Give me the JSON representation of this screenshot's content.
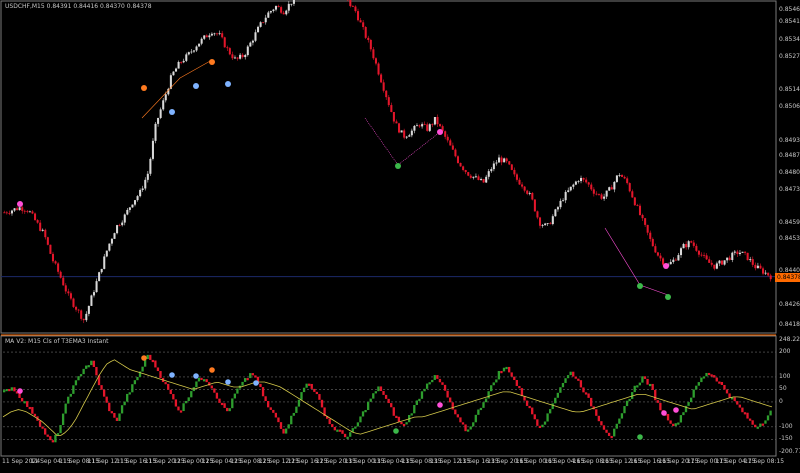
{
  "window": {
    "symbol_line": "USDCHF,M15  0.84391 0.84416 0.84370 0.84378",
    "indicator_line": "MA V2: M15 Cls of T3EMA3 Instant",
    "current_price": "0.84378"
  },
  "colors": {
    "background": "#000000",
    "axis": "#7a7a7a",
    "candle_up": "#d9d9d9",
    "candle_down": "#e4162b",
    "osc_up": "#2e9e2e",
    "osc_down": "#e4162b",
    "signal_line": "#d4c84a",
    "marker_buy": "#3cb84a",
    "marker_sell": "#ff4fd8",
    "marker_neutral": "#ff7a20",
    "marker_blue": "#7fb3ff",
    "current_box": "#ff6a00"
  },
  "price_axis": [
    "0.85465",
    "0.85415",
    "0.85344",
    "0.85273",
    "0.85140",
    "0.85069",
    "0.84931",
    "0.84870",
    "0.84800",
    "0.84730",
    "0.84595",
    "0.84530",
    "0.84402",
    "0.84378",
    "0.84261",
    "0.84181"
  ],
  "indicator_axis": [
    "248.2259",
    "200",
    "100",
    "50",
    "0",
    "-100",
    "-150",
    "-200.7791"
  ],
  "time_axis": [
    "11 Sep 2024",
    "11 Sep 04:15",
    "11 Sep 08:15",
    "11 Sep 12:15",
    "11 Sep 16:15",
    "11 Sep 20:15",
    "12 Sep 00:15",
    "12 Sep 04:15",
    "12 Sep 08:15",
    "12 Sep 12:15",
    "12 Sep 16:15",
    "12 Sep 20:15",
    "13 Sep 00:15",
    "13 Sep 04:15",
    "13 Sep 08:15",
    "13 Sep 12:15",
    "13 Sep 16:15",
    "13 Sep 20:15",
    "16 Sep 00:15",
    "16 Sep 04:15",
    "16 Sep 08:15",
    "16 Sep 12:15",
    "16 Sep 16:15",
    "16 Sep 20:15",
    "17 Sep 00:15",
    "17 Sep 04:15",
    "17 Sep 08:15"
  ],
  "chart_data": {
    "type": "line",
    "price_series": [
      0.8464,
      0.8465,
      0.8466,
      0.8465,
      0.846,
      0.8455,
      0.8445,
      0.8438,
      0.843,
      0.8425,
      0.842,
      0.843,
      0.844,
      0.845,
      0.8458,
      0.8462,
      0.8468,
      0.8472,
      0.848,
      0.85,
      0.851,
      0.852,
      0.8525,
      0.8528,
      0.8532,
      0.8535,
      0.8538,
      0.8536,
      0.853,
      0.8526,
      0.8528,
      0.8534,
      0.854,
      0.8545,
      0.8548,
      0.8546,
      0.855,
      0.8552,
      0.8556,
      0.8562,
      0.856,
      0.8558,
      0.8554,
      0.855,
      0.8546,
      0.8538,
      0.853,
      0.852,
      0.851,
      0.85,
      0.8495,
      0.8497,
      0.85,
      0.8498,
      0.8502,
      0.8496,
      0.849,
      0.8484,
      0.848,
      0.8478,
      0.8476,
      0.8482,
      0.8486,
      0.8484,
      0.8478,
      0.8475,
      0.847,
      0.846,
      0.8458,
      0.8464,
      0.847,
      0.8474,
      0.8478,
      0.8476,
      0.8472,
      0.847,
      0.8474,
      0.848,
      0.8476,
      0.8468,
      0.846,
      0.8452,
      0.8446,
      0.8442,
      0.8445,
      0.845,
      0.8452,
      0.8448,
      0.8444,
      0.8442,
      0.8444,
      0.8446,
      0.8448,
      0.8446,
      0.8442,
      0.844,
      0.8438
    ],
    "oscillator_series": [
      40,
      60,
      20,
      -20,
      -60,
      -120,
      -170,
      -100,
      20,
      80,
      140,
      160,
      60,
      -20,
      -80,
      0,
      60,
      120,
      190,
      140,
      80,
      20,
      -40,
      20,
      80,
      100,
      60,
      0,
      -40,
      40,
      80,
      120,
      60,
      -20,
      -60,
      -120,
      -60,
      20,
      80,
      40,
      -40,
      -100,
      -120,
      -140,
      -100,
      -40,
      20,
      60,
      0,
      -60,
      -100,
      -40,
      20,
      80,
      100,
      60,
      -20,
      -80,
      -120,
      -60,
      0,
      60,
      120,
      140,
      80,
      20,
      -40,
      -100,
      -60,
      20,
      80,
      120,
      80,
      20,
      -40,
      -100,
      -140,
      -80,
      0,
      60,
      100,
      60,
      -20,
      -60,
      -100,
      -40,
      20,
      80,
      120,
      100,
      60,
      20,
      -20,
      -60,
      -100,
      -80,
      -40
    ],
    "signal_series": [
      -60,
      -40,
      -30,
      -40,
      -60,
      -80,
      -110,
      -140,
      -120,
      -80,
      -20,
      40,
      100,
      150,
      170,
      150,
      130,
      120,
      110,
      100,
      90,
      80,
      70,
      60,
      50,
      60,
      70,
      80,
      70,
      60,
      60,
      70,
      80,
      80,
      70,
      60,
      40,
      20,
      0,
      -20,
      -40,
      -60,
      -80,
      -100,
      -120,
      -130,
      -120,
      -110,
      -100,
      -90,
      -80,
      -70,
      -60,
      -60,
      -50,
      -40,
      -30,
      -20,
      -10,
      0,
      10,
      20,
      30,
      40,
      40,
      30,
      20,
      10,
      0,
      -10,
      -20,
      -30,
      -40,
      -40,
      -30,
      -20,
      -10,
      0,
      10,
      20,
      30,
      30,
      20,
      10,
      0,
      -10,
      -20,
      -30,
      -20,
      -10,
      0,
      10,
      20,
      20,
      10,
      0,
      -10,
      -20
    ],
    "ylim_price": [
      0.84181,
      0.85465
    ],
    "ylim_indicator": [
      -200.7791,
      248.2259
    ]
  }
}
